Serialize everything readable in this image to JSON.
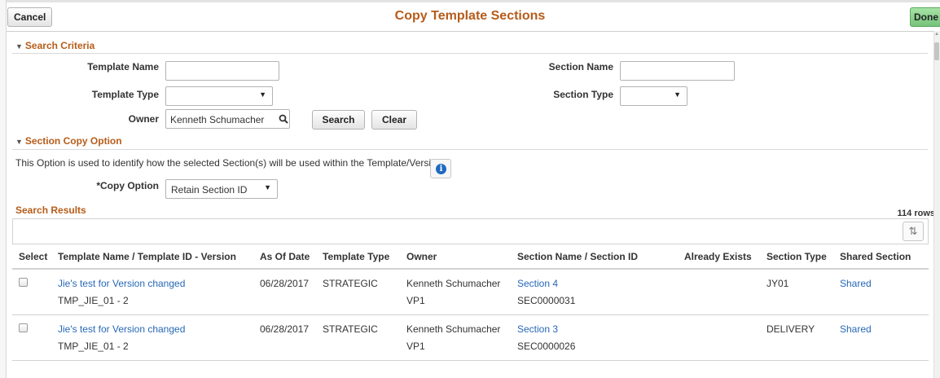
{
  "header": {
    "cancel_label": "Cancel",
    "title": "Copy Template Sections",
    "done_label": "Done"
  },
  "search_criteria": {
    "heading": "Search Criteria",
    "template_name_label": "Template Name",
    "template_name_value": "",
    "section_name_label": "Section Name",
    "section_name_value": "",
    "template_type_label": "Template Type",
    "template_type_value": "",
    "section_type_label": "Section Type",
    "section_type_value": "",
    "owner_label": "Owner",
    "owner_value": "Kenneth Schumacher",
    "search_label": "Search",
    "clear_label": "Clear"
  },
  "copy_option": {
    "heading": "Section Copy Option",
    "description": "This Option is used to identify how the selected Section(s) will be used within the Template/Version",
    "label": "*Copy Option",
    "value": "Retain Section ID"
  },
  "results": {
    "heading": "Search Results",
    "row_count": "114 rows",
    "columns": [
      "Select",
      "Template Name / Template ID - Version",
      "As Of Date",
      "Template Type",
      "Owner",
      "Section Name / Section ID",
      "Already Exists",
      "Section Type",
      "Shared Section"
    ],
    "rows": [
      {
        "template_name": "Jie's test for Version changed",
        "template_id": "TMP_JIE_01 - 2",
        "as_of_date": "06/28/2017",
        "template_type": "STRATEGIC",
        "owner": "Kenneth Schumacher",
        "owner_id": "VP1",
        "section_name": "Section 4",
        "section_id": "SEC0000031",
        "already_exists": "",
        "section_type": "JY01",
        "shared": "Shared"
      },
      {
        "template_name": "Jie's test for Version changed",
        "template_id": "TMP_JIE_01 - 2",
        "as_of_date": "06/28/2017",
        "template_type": "STRATEGIC",
        "owner": "Kenneth Schumacher",
        "owner_id": "VP1",
        "section_name": "Section 3",
        "section_id": "SEC0000026",
        "already_exists": "",
        "section_type": "DELIVERY",
        "shared": "Shared"
      }
    ]
  },
  "icons": {
    "lookup": "magnifier-icon",
    "info": "info-icon",
    "sort": "sort-icon",
    "collapse": "triangle-down-icon"
  },
  "colors": {
    "title": "#b65c19",
    "link": "#2768b7",
    "done_button": "#76c27a"
  }
}
